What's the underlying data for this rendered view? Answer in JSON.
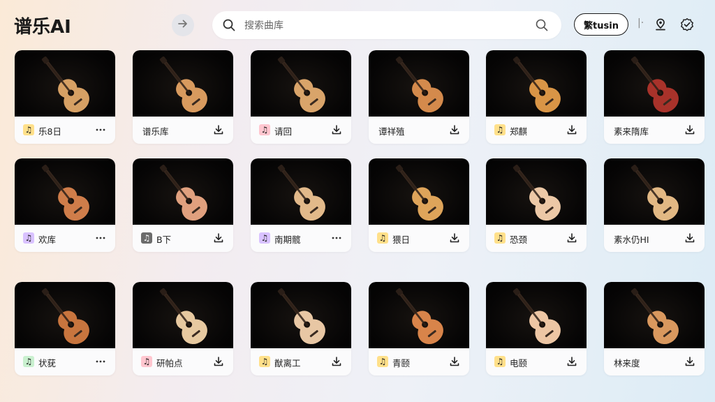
{
  "app": {
    "title": "谱乐AI"
  },
  "search": {
    "placeholder": "搜索曲库"
  },
  "user": {
    "label": "繁tusin"
  },
  "header": {
    "divider": "|·"
  },
  "icons": {
    "back": "arrow-right-icon",
    "search_lead": "search-icon",
    "search_trail": "search-icon",
    "location": "location-pin-icon",
    "verified": "badge-check-icon",
    "download": "download-icon",
    "more": "more-icon",
    "note": "music-note-icon"
  },
  "colors": {
    "badge_yellow": "#ffe08a",
    "badge_pink": "#ffc6cf",
    "badge_purple": "#d9c2ff",
    "badge_green": "#c9f0cf",
    "badge_gray": "#6b6b6b",
    "thumb_bg": "#050505"
  },
  "cards": [
    {
      "label": "乐8日",
      "badge": "yellow",
      "action": "more",
      "guitar": "#d6a064"
    },
    {
      "label": "谱乐库",
      "badge": "",
      "action": "download",
      "guitar": "#d89a5e"
    },
    {
      "label": "请回",
      "badge": "pink",
      "action": "download",
      "guitar": "#d9a46a"
    },
    {
      "label": "谭祥殖",
      "badge": "",
      "action": "download",
      "guitar": "#d48a4c"
    },
    {
      "label": "郑麒",
      "badge": "yellow",
      "action": "download",
      "guitar": "#d99546"
    },
    {
      "label": "素来隋库",
      "badge": "",
      "action": "download",
      "guitar": "#a8322a"
    },
    {
      "label": "欢库",
      "badge": "purple",
      "action": "more",
      "guitar": "#cf7d4a"
    },
    {
      "label": "B下",
      "badge": "gray",
      "action": "download",
      "guitar": "#e0a07e"
    },
    {
      "label": "南期髋",
      "badge": "purple",
      "action": "more",
      "guitar": "#e2b98a"
    },
    {
      "label": "猥日",
      "badge": "yellow",
      "action": "download",
      "guitar": "#dea45a"
    },
    {
      "label": "恐颈",
      "badge": "yellow",
      "action": "download",
      "guitar": "#ecc8a6"
    },
    {
      "label": "素水仍HI",
      "badge": "",
      "action": "download",
      "guitar": "#e2b884"
    },
    {
      "label": "状莸",
      "badge": "green",
      "action": "more",
      "guitar": "#c8753e"
    },
    {
      "label": "研帕点",
      "badge": "pink",
      "action": "download",
      "guitar": "#e7c9a0"
    },
    {
      "label": "猷离工",
      "badge": "yellow",
      "action": "download",
      "guitar": "#e8c7a4"
    },
    {
      "label": "青颐",
      "badge": "yellow",
      "action": "download",
      "guitar": "#d8844a"
    },
    {
      "label": "电颐",
      "badge": "yellow",
      "action": "download",
      "guitar": "#edc6a4"
    },
    {
      "label": "林来度",
      "badge": "",
      "action": "download",
      "guitar": "#d9985e"
    }
  ]
}
